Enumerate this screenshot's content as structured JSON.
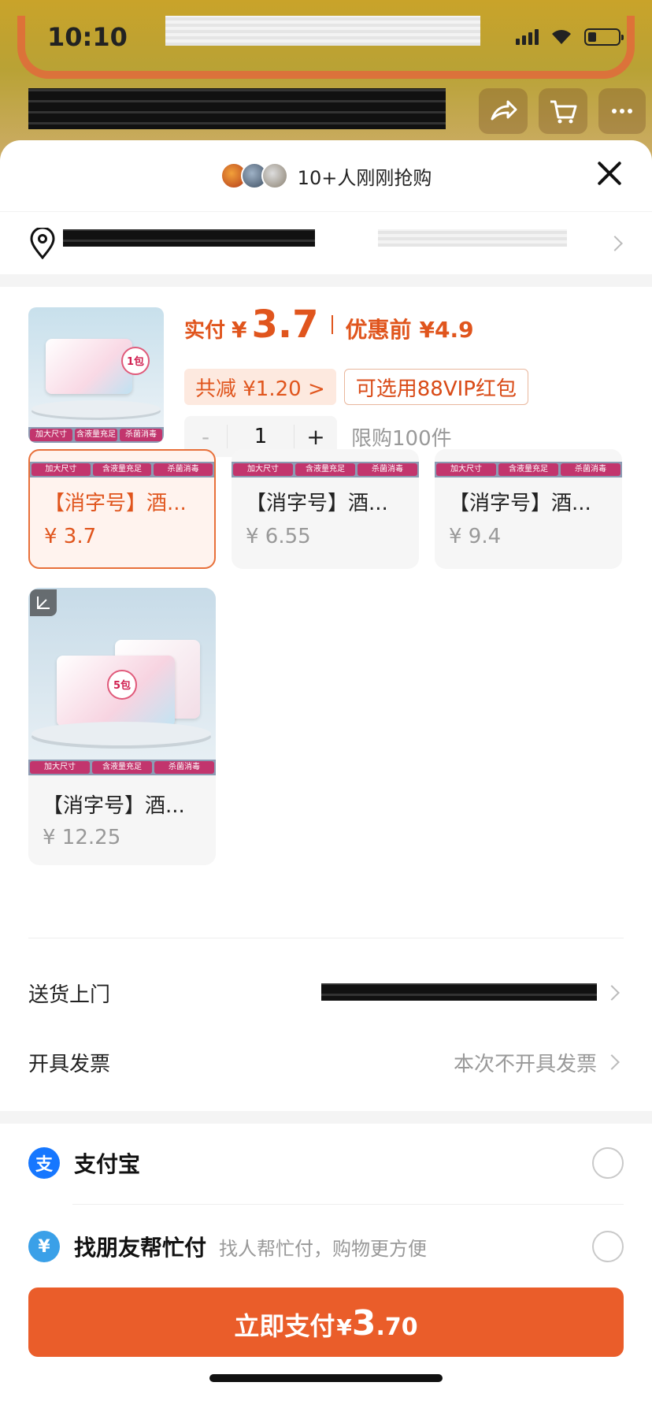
{
  "status_bar": {
    "time": "10:10"
  },
  "sheet": {
    "header": {
      "rush_text": "10+人刚刚抢购"
    },
    "product": {
      "paid_label": "实付",
      "currency": "¥",
      "paid_value": "3.7",
      "before_label": "优惠前",
      "before_value": "¥4.9",
      "discount_chip": "共减 ¥1.20 >",
      "vip_chip": "可选用88VIP红包",
      "qty_minus": "-",
      "quantity": "1",
      "qty_plus": "+",
      "limit_text": "限购100件",
      "thumb_badge": "1包",
      "tags": [
        "加大尺寸",
        "含液量充足",
        "杀菌消毒"
      ]
    },
    "variants": [
      {
        "name": "【消字号】酒...",
        "price": "¥ 3.7",
        "selected": true
      },
      {
        "name": "【消字号】酒...",
        "price": "¥ 6.55",
        "selected": false
      },
      {
        "name": "【消字号】酒...",
        "price": "¥ 9.4",
        "selected": false
      },
      {
        "name": "【消字号】酒...",
        "price": "¥ 12.25",
        "selected": false,
        "badge": "5包"
      }
    ],
    "delivery": {
      "label": "送货上门"
    },
    "invoice": {
      "label": "开具发票",
      "value": "本次不开具发票"
    },
    "payment": {
      "alipay": {
        "icon": "alipay-icon",
        "label": "支付宝"
      },
      "friend": {
        "icon": "friend-pay-icon",
        "label": "找朋友帮忙付",
        "sub": "找人帮忙付，购物更方便"
      }
    },
    "pay_button": {
      "label": "立即支付",
      "currency": "¥",
      "int": "3",
      "dec": ".70"
    }
  },
  "colors": {
    "accent": "#ea5d2a",
    "price": "#e0551d",
    "alipay": "#1677ff"
  }
}
